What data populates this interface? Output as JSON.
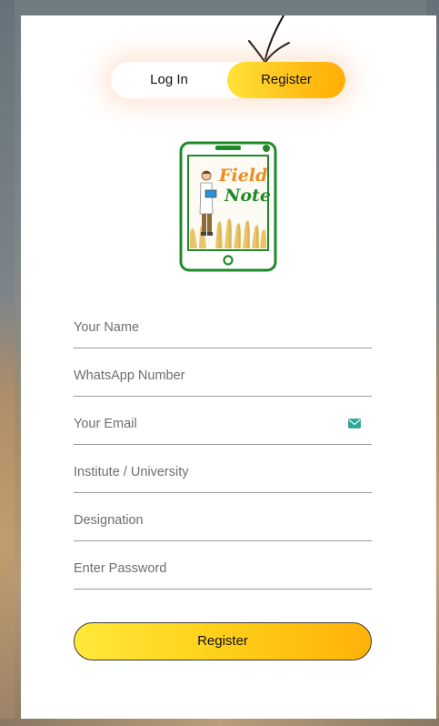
{
  "auth_toggle": {
    "login_label": "Log In",
    "register_label": "Register",
    "active": "register"
  },
  "logo": {
    "line1": "Field",
    "line2": "Note"
  },
  "form": {
    "name_placeholder": "Your Name",
    "whatsapp_placeholder": "WhatsApp Number",
    "email_placeholder": "Your Email",
    "institute_placeholder": "Institute / University",
    "designation_placeholder": "Designation",
    "password_placeholder": "Enter Password",
    "submit_label": "Register"
  },
  "colors": {
    "accent_start": "#ffe23a",
    "accent_end": "#ffae05",
    "logo_green": "#1f8a2a",
    "logo_orange": "#f08a1c"
  },
  "icons": {
    "email_field": "envelope-icon",
    "annotation": "hand-drawn-arrow-icon"
  }
}
